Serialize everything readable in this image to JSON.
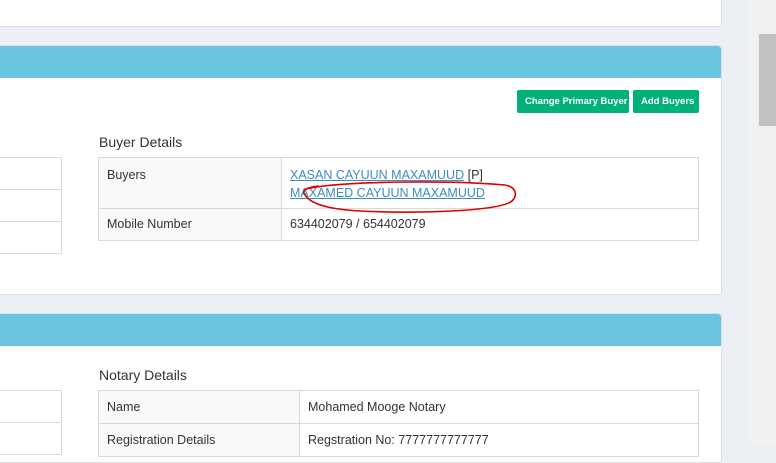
{
  "buyer_section": {
    "change_primary_label": "Change Primary Buyer",
    "add_buyers_label": "Add Buyers",
    "title": "Buyer Details",
    "buyers_label": "Buyers",
    "buyer_1": "XASAN CAYUUN MAXAMUUD",
    "buyer_1_tag": "[P]",
    "buyer_2": "MAXAMED CAYUUN MAXAMUUD",
    "mobile_label": "Mobile Number",
    "mobile_value": "634402079 / 654402079"
  },
  "notary_section": {
    "title": "Notary Details",
    "name_label": "Name",
    "name_value": "Mohamed Mooge Notary",
    "registration_label": "Registration Details",
    "registration_value": "Regstration No: 7777777777777"
  },
  "colors": {
    "header_bar": "#69c5e0",
    "button_green": "#00b17a",
    "link_blue": "#3c8dbc",
    "annotation_red": "#e00000"
  }
}
